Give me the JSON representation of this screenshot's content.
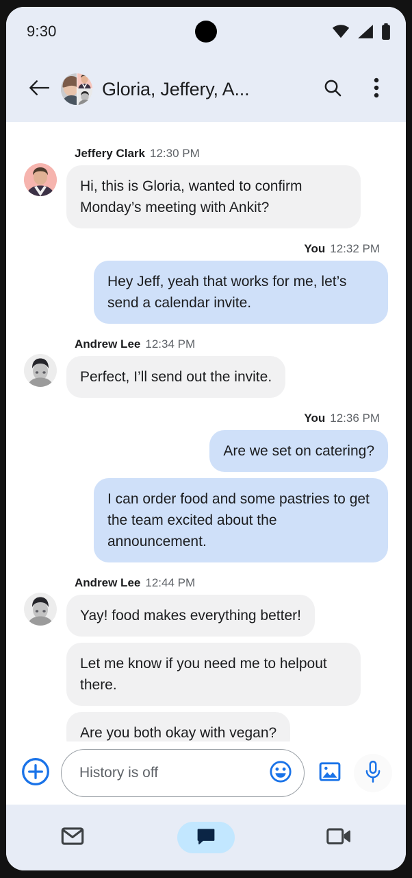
{
  "status_bar": {
    "time": "9:30",
    "icons": [
      "wifi-icon",
      "cellular-signal-icon",
      "battery-icon"
    ]
  },
  "app_bar": {
    "back_icon": "back-arrow-icon",
    "avatar": "group-avatar",
    "title": "Gloria, Jeffery, A...",
    "search_icon": "search-icon",
    "overflow_icon": "more-vert-icon"
  },
  "conversation": {
    "groups": [
      {
        "direction": "incoming",
        "sender": "Jeffery Clark",
        "time": "12:30 PM",
        "avatar": "jeffery-avatar",
        "messages": [
          "Hi, this is Gloria, wanted to confirm Monday’s meeting with Ankit?"
        ]
      },
      {
        "direction": "outgoing",
        "sender": "You",
        "time": "12:32 PM",
        "messages": [
          "Hey Jeff, yeah that works for me, let’s send a calendar invite."
        ]
      },
      {
        "direction": "incoming",
        "sender": "Andrew Lee",
        "time": "12:34 PM",
        "avatar": "andrew-avatar",
        "messages": [
          "Perfect, I’ll send out the invite."
        ]
      },
      {
        "direction": "outgoing",
        "sender": "You",
        "time": "12:36 PM",
        "messages": [
          "Are we set on catering?",
          "I can order food and some pastries to get the team excited about the announcement."
        ]
      },
      {
        "direction": "incoming",
        "sender": "Andrew Lee",
        "time": "12:44 PM",
        "avatar": "andrew-avatar",
        "messages": [
          "Yay! food makes everything better!",
          "Let me know if you need me to helpout there.",
          "Are you both okay with vegan?"
        ]
      }
    ]
  },
  "composer": {
    "plus_icon": "add-circle-icon",
    "placeholder": "History is off",
    "emoji_icon": "emoji-icon",
    "gallery_icon": "image-icon",
    "mic_icon": "microphone-icon"
  },
  "bottom_nav": {
    "items": [
      {
        "icon": "mail-icon",
        "label": "Mail",
        "active": false
      },
      {
        "icon": "chat-icon",
        "label": "Chat",
        "active": true
      },
      {
        "icon": "video-camera-icon",
        "label": "Meet",
        "active": false
      }
    ]
  },
  "colors": {
    "app_bar_bg": "#e7ecf6",
    "incoming_bubble": "#f1f1f2",
    "outgoing_bubble": "#cfe0f9",
    "accent_blue": "#1a73e8",
    "active_pill": "#c2e7ff",
    "text_primary": "#1b1c1e",
    "text_secondary": "#5f6368"
  }
}
